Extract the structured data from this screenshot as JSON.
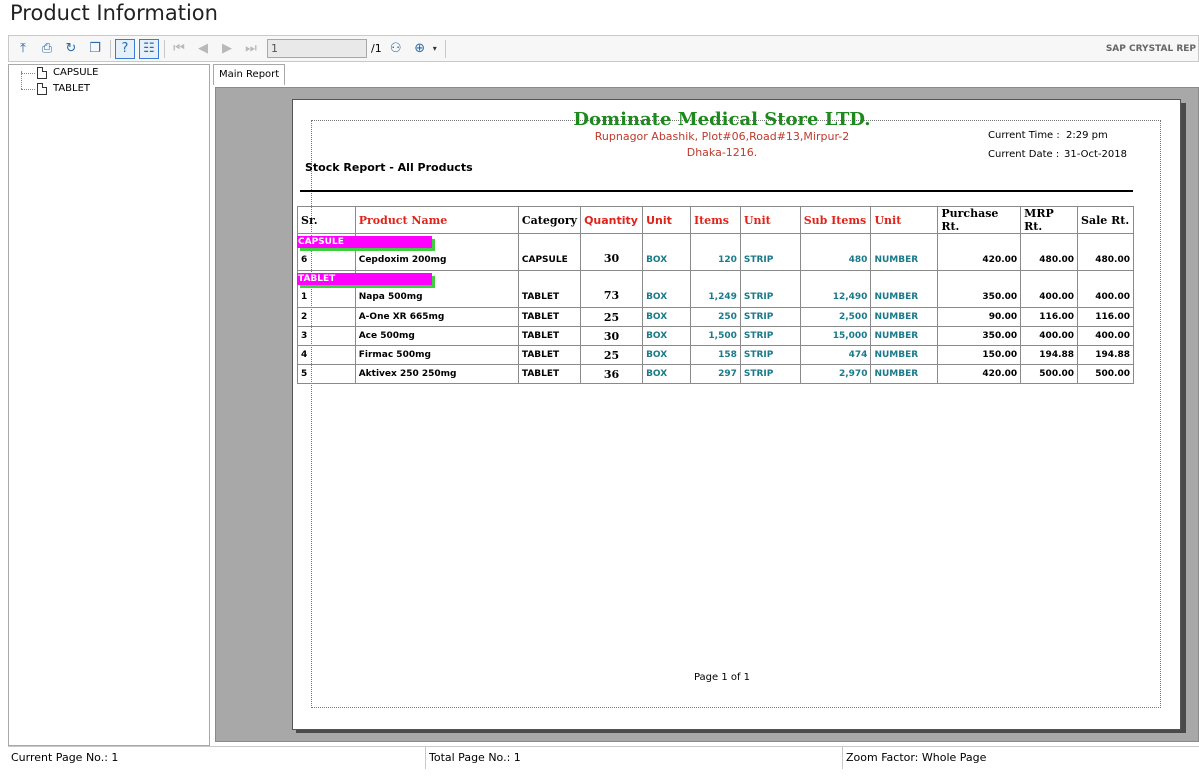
{
  "window": {
    "title": "Product Information"
  },
  "toolbar": {
    "page_input_value": "1",
    "page_total": "/1",
    "brand": "SAP CRYSTAL REP"
  },
  "tree": {
    "items": [
      {
        "label": "CAPSULE"
      },
      {
        "label": "TABLET"
      }
    ]
  },
  "tabs": [
    {
      "label": "Main Report"
    }
  ],
  "report": {
    "company": "Dominate Medical Store LTD.",
    "address_line1": "Rupnagor Abashik, Plot#06,Road#13,Mirpur-2",
    "address_line2": "Dhaka-1216.",
    "current_time_label": "Current Time :",
    "current_time": "2:29 pm",
    "current_date_label": "Current Date :",
    "current_date": "31-Oct-2018",
    "title": "Stock Report - All Products",
    "columns": [
      "Sr.",
      "Product Name",
      "Category",
      "Quantity",
      "Unit",
      "Items",
      "Unit",
      "Sub Items",
      "Unit",
      "Purchase Rt.",
      "MRP Rt.",
      "Sale Rt."
    ],
    "groups": [
      {
        "name": "CAPSULE",
        "rows": [
          {
            "sr": "6",
            "name": "Cepdoxim 200mg",
            "category": "CAPSULE",
            "qty": "30",
            "unit1": "BOX",
            "items": "120",
            "unit2": "STRIP",
            "sub_items": "480",
            "unit3": "NUMBER",
            "purchase": "420.00",
            "mrp": "480.00",
            "sale": "480.00"
          }
        ]
      },
      {
        "name": "TABLET",
        "rows": [
          {
            "sr": "1",
            "name": "Napa 500mg",
            "category": "TABLET",
            "qty": "73",
            "unit1": "BOX",
            "items": "1,249",
            "unit2": "STRIP",
            "sub_items": "12,490",
            "unit3": "NUMBER",
            "purchase": "350.00",
            "mrp": "400.00",
            "sale": "400.00"
          },
          {
            "sr": "2",
            "name": "A-One XR 665mg",
            "category": "TABLET",
            "qty": "25",
            "unit1": "BOX",
            "items": "250",
            "unit2": "STRIP",
            "sub_items": "2,500",
            "unit3": "NUMBER",
            "purchase": "90.00",
            "mrp": "116.00",
            "sale": "116.00"
          },
          {
            "sr": "3",
            "name": "Ace 500mg",
            "category": "TABLET",
            "qty": "30",
            "unit1": "BOX",
            "items": "1,500",
            "unit2": "STRIP",
            "sub_items": "15,000",
            "unit3": "NUMBER",
            "purchase": "350.00",
            "mrp": "400.00",
            "sale": "400.00"
          },
          {
            "sr": "4",
            "name": "Firmac 500mg",
            "category": "TABLET",
            "qty": "25",
            "unit1": "BOX",
            "items": "158",
            "unit2": "STRIP",
            "sub_items": "474",
            "unit3": "NUMBER",
            "purchase": "150.00",
            "mrp": "194.88",
            "sale": "194.88"
          },
          {
            "sr": "5",
            "name": "Aktivex 250 250mg",
            "category": "TABLET",
            "qty": "36",
            "unit1": "BOX",
            "items": "297",
            "unit2": "STRIP",
            "sub_items": "2,970",
            "unit3": "NUMBER",
            "purchase": "420.00",
            "mrp": "500.00",
            "sale": "500.00"
          }
        ]
      }
    ],
    "page_footer": "Page 1 of 1"
  },
  "status_bar": {
    "current_page": "Current Page No.: 1",
    "total_page": "Total Page No.: 1",
    "zoom": "Zoom Factor: Whole Page"
  },
  "colors": {
    "company": "#1e8a1e",
    "address": "#c0392b",
    "header_red": "#e2231a",
    "unit_teal": "#1a7a8a",
    "group_band": "#ff00ff",
    "group_shadow": "#3fcf3f"
  }
}
